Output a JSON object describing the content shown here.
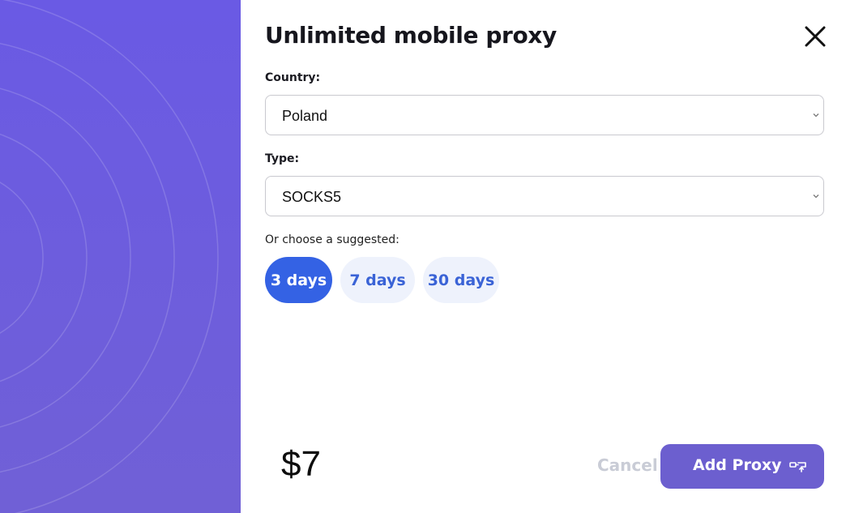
{
  "modal": {
    "title": "Unlimited mobile proxy",
    "close_icon": "close-icon"
  },
  "country": {
    "label": "Country:",
    "selected": "Poland"
  },
  "type": {
    "label": "Type:",
    "selected": "SOCKS5"
  },
  "suggested": {
    "label": "Or choose a suggested:",
    "options": [
      {
        "label": "3 days",
        "active": true
      },
      {
        "label": "7 days",
        "active": false
      },
      {
        "label": "30 days",
        "active": false
      }
    ]
  },
  "footer": {
    "price": "$7",
    "cancel_label": "Cancel",
    "add_label": "Add Proxy",
    "add_icon": "proxy-plug-icon"
  },
  "colors": {
    "side_panel": "#6a5ae4",
    "accent_blue": "#3462e4",
    "button_purple": "#6c5fcf",
    "pill_inactive_bg": "#eef2fc"
  }
}
